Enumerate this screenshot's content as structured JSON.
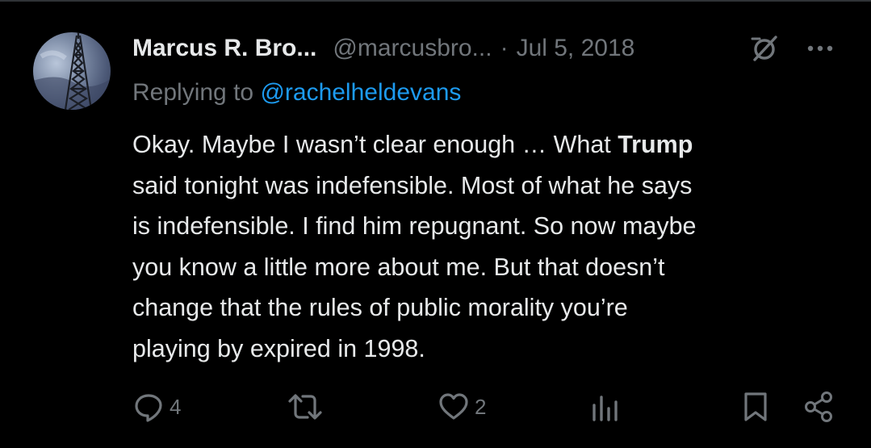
{
  "tweet": {
    "author_name": "Marcus R. Bro...",
    "author_handle": "@marcusbro...",
    "separator": "·",
    "date": "Jul 5, 2018",
    "replying_prefix": "Replying to",
    "replying_to": "@rachelheldevans",
    "text_lines": [
      {
        "pre": "Okay. Maybe I wasn’t clear enough … What ",
        "bold": "Trump",
        "post": ""
      },
      {
        "pre": "said tonight was indefensible. Most of what he says",
        "bold": "",
        "post": ""
      },
      {
        "pre": "is indefensible. I find him repugnant. So now maybe",
        "bold": "",
        "post": ""
      },
      {
        "pre": "you know a little more about me. But that doesn’t",
        "bold": "",
        "post": ""
      },
      {
        "pre": "change that the rules of public morality you’re",
        "bold": "",
        "post": ""
      },
      {
        "pre": "playing by expired in 1998.",
        "bold": "",
        "post": ""
      }
    ],
    "actions": {
      "reply_count": "4",
      "retweet_count": "",
      "like_count": "2",
      "view_count": ""
    }
  },
  "icons": {
    "avatar": "avatar-radio-tower",
    "no_edit": "no-edit-icon",
    "more": "more-icon",
    "reply": "reply-icon",
    "retweet": "retweet-icon",
    "like": "like-icon",
    "views": "views-icon",
    "bookmark": "bookmark-icon",
    "share": "share-icon"
  },
  "colors": {
    "background": "#000000",
    "primary_text": "#e7e9ea",
    "secondary_text": "#71767b",
    "link": "#1d9bf0"
  }
}
